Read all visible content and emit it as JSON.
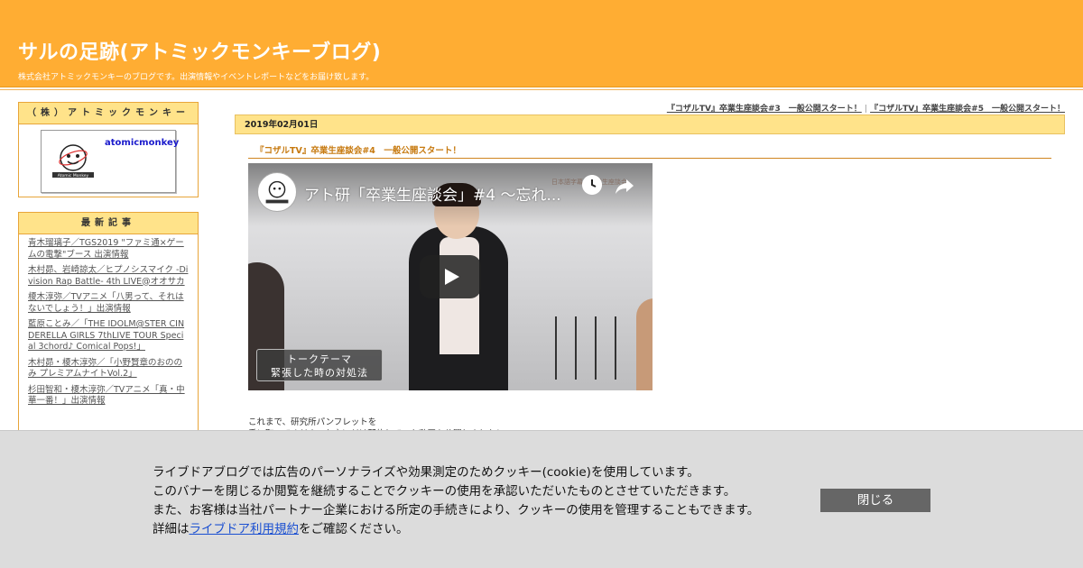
{
  "header": {
    "title": "サルの足跡(アトミックモンキーブログ)",
    "description": "株式会社アトミックモンキーのブログです。出演情報やイベントレポートなどをお届け致します。"
  },
  "sidebar": {
    "profile": {
      "heading": "（株）アトミックモンキー",
      "name": "atomicmonkey"
    },
    "recent": {
      "heading": "最新記事",
      "items": [
        "青木瑠璃子／TGS2019 \"ファミ通×ゲームの電撃\"ブース 出演情報",
        "木村昴、岩崎諒太／ヒプノシスマイク -Division Rap Battle- 4th LIVE@オオサカ",
        "榎木淳弥／TVアニメ「八男って、それはないでしょう！」出演情報",
        "藍原ことみ／「THE IDOLM@STER CINDERELLA GIRLS 7thLIVE TOUR Special 3chord♪ Comical Pops!」",
        "木村昴・榎木淳弥／「小野賢章のおののみ プレミアムナイトVol.2」",
        "杉田智和・榎木淳弥／TVアニメ「真・中華一番！」出演情報"
      ]
    }
  },
  "main": {
    "nav": {
      "prev": "『コザルTV』卒業生座談会#3　一般公開スタート！",
      "separator": "|",
      "next": "『コザルTV』卒業生座談会#5　一般公開スタート！"
    },
    "date": "2019年02月01日",
    "post_title": "『コザルTV』卒業生座談会#4　一般公開スタート！",
    "video": {
      "title": "アト研「卒業生座談会」#4 〜忘れ...",
      "corner_text": "日本語字幕　卒業生座談会",
      "caption_line1": "トークテーマ",
      "caption_line2": "緊張した時の対処法"
    },
    "body_line1": "これまで、研究所パンフレットを",
    "body_line2": "手に取ってくださった方にだけ配信していた動画を公開しました！"
  },
  "cookie": {
    "line1": "ライブドアブログでは広告のパーソナライズや効果測定のためクッキー(cookie)を使用しています。",
    "line2": "このバナーを閉じるか閲覧を継続することでクッキーの使用を承認いただいたものとさせていただきます。",
    "line3": "また、お客様は当社パートナー企業における所定の手続きにより、クッキーの使用を管理することもできます。",
    "line4_prefix": "詳細は",
    "line4_link": "ライブドア利用規約",
    "line4_suffix": "をご確認ください。",
    "close_label": "閉じる"
  },
  "colors": {
    "header_bg": "#ffad33",
    "sidebar_head_bg": "#ffe38a",
    "post_title": "#c77a10",
    "cookie_bg": "#dcdcdc",
    "close_button_bg": "#666666",
    "link_blue": "#1a4fd1"
  }
}
